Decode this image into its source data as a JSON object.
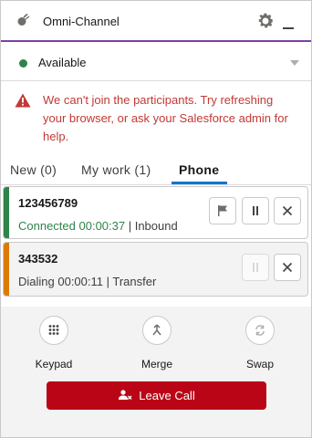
{
  "header": {
    "title": "Omni-Channel"
  },
  "status": {
    "label": "Available",
    "color": "#2e844a"
  },
  "error": {
    "message": "We can't join the participants. Try refreshing your browser, or ask your Salesforce admin for help."
  },
  "tabs": [
    {
      "label": "New (0)"
    },
    {
      "label": "My work (1)"
    },
    {
      "label": "Phone",
      "active": true
    }
  ],
  "calls": [
    {
      "number": "123456789",
      "status": "Connected 00:00:37",
      "separator": " | ",
      "direction": "Inbound",
      "accent": "#2e844a"
    },
    {
      "number": "343532",
      "status": "Dialing 00:00:11",
      "separator": " | ",
      "direction": "Transfer",
      "accent": "#dd7a01"
    }
  ],
  "controls": {
    "keypad": "Keypad",
    "merge": "Merge",
    "swap": "Swap"
  },
  "leave_call": {
    "label": "Leave Call",
    "color": "#ba0517"
  }
}
